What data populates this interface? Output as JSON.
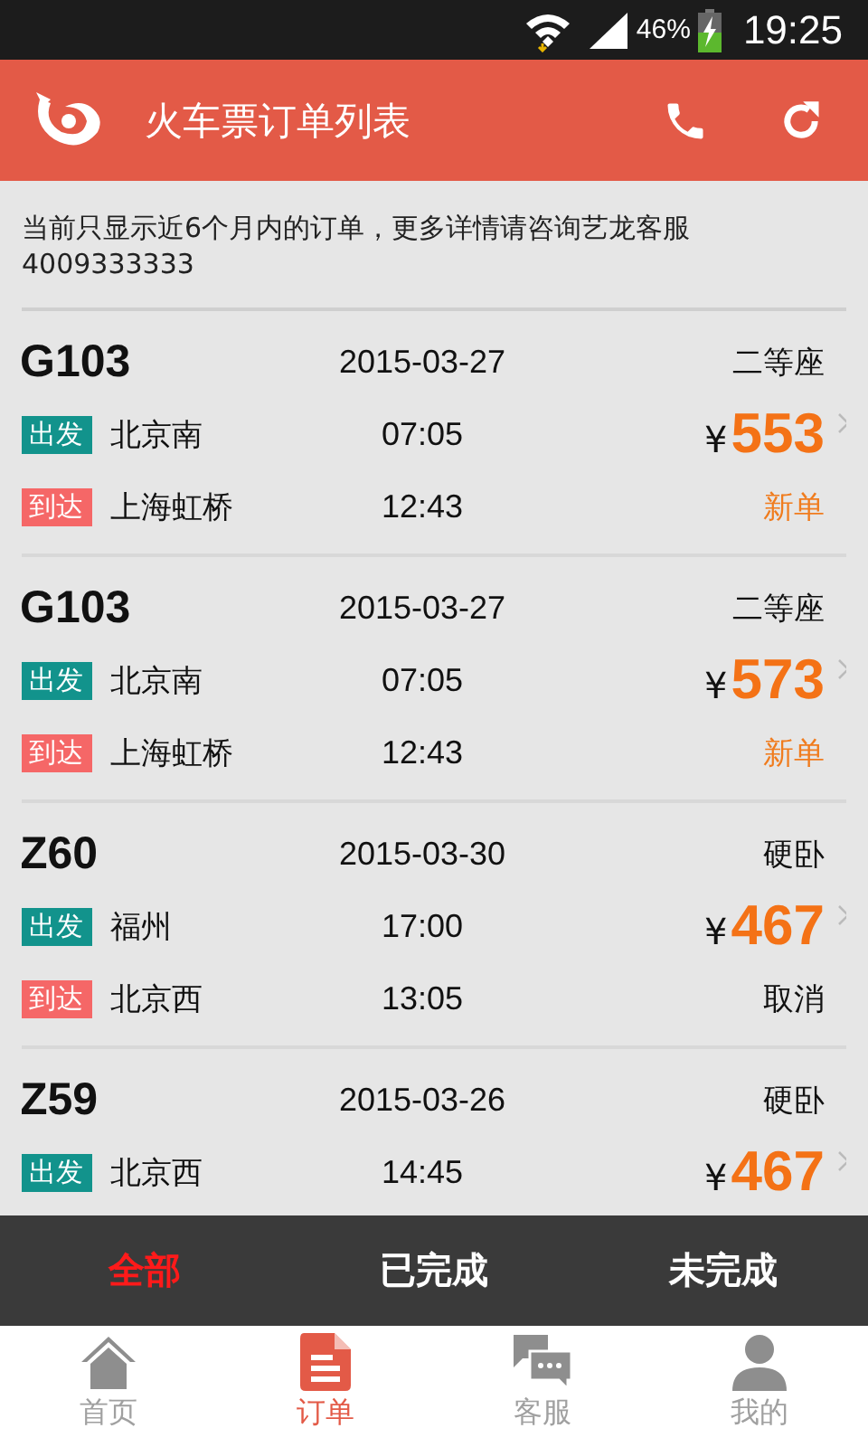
{
  "status_bar": {
    "battery": "46%",
    "time": "19:25"
  },
  "header": {
    "title": "火车票订单列表"
  },
  "notice": "当前只显示近6个月内的订单，更多详情请咨询艺龙客服4009333333",
  "orders": [
    {
      "train": "G103",
      "date": "2015-03-27",
      "seat": "二等座",
      "depart_label": "出发",
      "depart_station": "北京南",
      "depart_time": "07:05",
      "arrive_label": "到达",
      "arrive_station": "上海虹桥",
      "arrive_time": "12:43",
      "currency": "¥",
      "price": "553",
      "status": "新单",
      "color": "#f07c1e"
    },
    {
      "train": "G103",
      "date": "2015-03-27",
      "seat": "二等座",
      "depart_label": "出发",
      "depart_station": "北京南",
      "depart_time": "07:05",
      "arrive_label": "到达",
      "arrive_station": "上海虹桥",
      "arrive_time": "12:43",
      "currency": "¥",
      "price": "573",
      "status": "新单",
      "color": "#f07c1e"
    },
    {
      "train": "Z60",
      "date": "2015-03-30",
      "seat": "硬卧",
      "depart_label": "出发",
      "depart_station": "福州",
      "depart_time": "17:00",
      "arrive_label": "到达",
      "arrive_station": "北京西",
      "arrive_time": "13:05",
      "currency": "¥",
      "price": "467",
      "status": "取消",
      "color": "#111111"
    },
    {
      "train": "Z59",
      "date": "2015-03-26",
      "seat": "硬卧",
      "depart_label": "出发",
      "depart_station": "北京西",
      "depart_time": "14:45",
      "currency": "¥",
      "price": "467"
    }
  ],
  "filter_tabs": [
    {
      "label": "全部",
      "selected": true
    },
    {
      "label": "已完成",
      "selected": false
    },
    {
      "label": "未完成",
      "selected": false
    }
  ],
  "nav": [
    {
      "kind": "home",
      "label": "首页",
      "selected": false
    },
    {
      "kind": "orders",
      "label": "订单",
      "selected": true
    },
    {
      "kind": "service",
      "label": "客服",
      "selected": false
    },
    {
      "kind": "profile",
      "label": "我的",
      "selected": false
    }
  ]
}
